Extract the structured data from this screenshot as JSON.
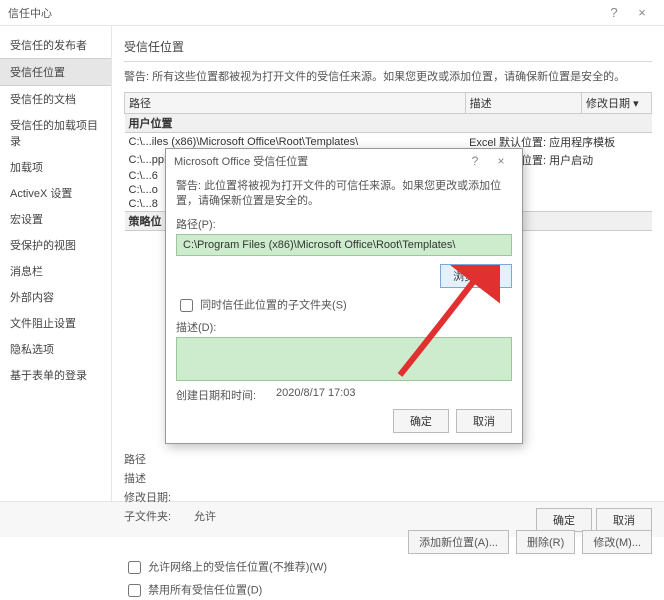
{
  "window": {
    "title": "信任中心",
    "help": "?",
    "close": "×"
  },
  "sidebar": {
    "items": [
      "受信任的发布者",
      "受信任位置",
      "受信任的文档",
      "受信任的加载项目录",
      "加载项",
      "ActiveX 设置",
      "宏设置",
      "受保护的视图",
      "消息栏",
      "外部内容",
      "文件阻止设置",
      "隐私选项",
      "基于表单的登录"
    ],
    "selected_index": 1
  },
  "content": {
    "section_title": "受信任位置",
    "warning": "警告: 所有这些位置都被视为打开文件的受信任来源。如果您更改或添加位置，请确保新位置是安全的。",
    "columns": {
      "path": "路径",
      "desc": "描述",
      "date": "修改日期"
    },
    "date_sort_glyph": "▾",
    "user_locations_label": "用户位置",
    "rows": [
      {
        "path": "C:\\...iles (x86)\\Microsoft Office\\Root\\Templates\\",
        "desc": "Excel 默认位置: 应用程序模板"
      },
      {
        "path": "C:\\...ppData\\Roaming\\Microsoft\\Excel\\XLSTART\\",
        "desc": "Excel 默认位置: 用户启动"
      }
    ],
    "truncated_rows": [
      "C:\\...6",
      "C:\\...o",
      "C:\\...8"
    ],
    "policy_locations_label": "策略位",
    "fields": {
      "path_label": "路径",
      "desc_label": "描述",
      "modified_label": "修改日期:",
      "subfolder_label": "子文件夹:",
      "subfolder_value": "允许"
    },
    "buttons": {
      "add": "添加新位置(A)...",
      "remove": "删除(R)",
      "modify": "修改(M)..."
    },
    "checks": {
      "allow_network": "允许网络上的受信任位置(不推荐)(W)",
      "disable_all": "禁用所有受信任位置(D)"
    }
  },
  "footer": {
    "ok": "确定",
    "cancel": "取消"
  },
  "dialog": {
    "title": "Microsoft Office 受信任位置",
    "help": "?",
    "close": "×",
    "warning": "警告: 此位置将被视为打开文件的可信任来源。如果您更改或添加位置，请确保新位置是安全的。",
    "path_label": "路径(P):",
    "path_value": "C:\\Program Files (x86)\\Microsoft Office\\Root\\Templates\\",
    "browse": "浏览(B)...",
    "trust_sub_label": "同时信任此位置的子文件夹(S)",
    "desc_label": "描述(D):",
    "created_label": "创建日期和时间:",
    "created_value": "2020/8/17 17:03",
    "ok": "确定",
    "cancel": "取消"
  }
}
